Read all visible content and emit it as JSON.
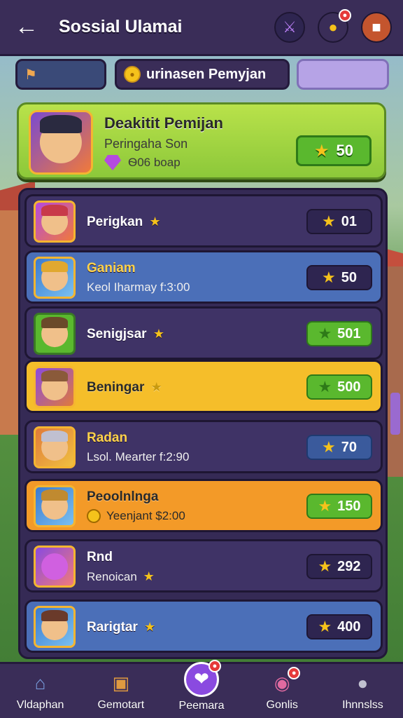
{
  "header": {
    "title": "Sossial Ulamai"
  },
  "top_icons": [
    {
      "name": "sword-icon",
      "badge": ""
    },
    {
      "name": "coin-icon",
      "badge": ""
    },
    {
      "name": "chest-icon",
      "badge": ""
    }
  ],
  "tabs": [
    {
      "label": ""
    },
    {
      "label": "urinasen Pemyjan"
    },
    {
      "label": ""
    }
  ],
  "hero": {
    "title": "Deakitit Pemijan",
    "subtitle": "Peringaha Son",
    "gems": "Ѳ06 boap",
    "score": "50"
  },
  "rows": [
    {
      "name": "Perigkan",
      "sub": "",
      "score": "01",
      "style": "dark"
    },
    {
      "name": "Ganiam",
      "sub": "Keol Iharmay f:3:00",
      "score": "50",
      "style": "blue"
    },
    {
      "name": "Senigjsar",
      "sub": "",
      "score": "501",
      "style": "dark"
    },
    {
      "name": "Beningar",
      "sub": "",
      "score": "500",
      "style": "yellow"
    },
    {
      "name": "Radan",
      "sub": "Lsol. Mearter f:2:90",
      "score": "70",
      "style": "dark"
    },
    {
      "name": "Peoolnlnga",
      "sub": "Yeenjant $2:00",
      "score": "150",
      "style": "orange"
    },
    {
      "name": "Rnd",
      "sub": "Renoican",
      "score": "292",
      "style": "dark"
    },
    {
      "name": "Rarigtar",
      "sub": "",
      "score": "400",
      "style": "blue"
    }
  ],
  "bottom_nav": [
    {
      "label": "Vldaphan"
    },
    {
      "label": "Gemotart"
    },
    {
      "label": "Peemara"
    },
    {
      "label": "Gonlis"
    },
    {
      "label": "Ihnnslss"
    }
  ],
  "colors": {
    "accent": "#f5c21b",
    "panel": "#352a55",
    "hero": "#b9e24a"
  }
}
